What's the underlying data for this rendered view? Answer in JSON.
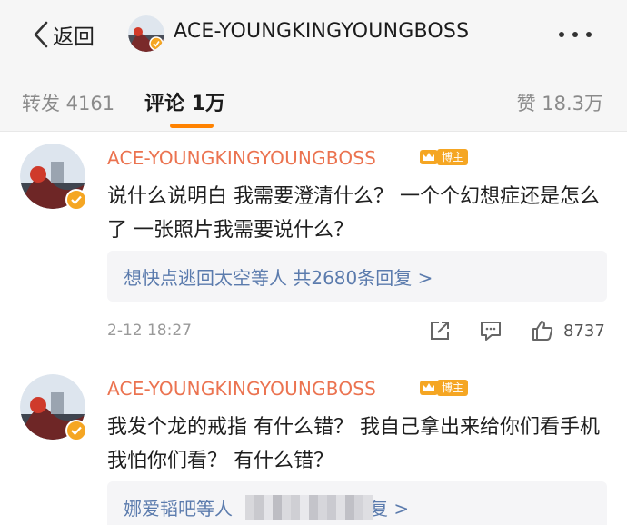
{
  "header": {
    "back_label": "返回",
    "title": "ACE-YOUNGKINGYOUNGBOSS"
  },
  "tabs": {
    "repost": "转发 4161",
    "comment": "评论 1万",
    "like": "赞 18.3万"
  },
  "colors": {
    "accent": "#ff8200",
    "username": "#eb7350",
    "link": "#5b7bad",
    "badge": "#f5a623"
  },
  "comments": [
    {
      "username": "ACE-YOUNGKINGYOUNGBOSS",
      "badge": "博主",
      "text": "说什么说明白 我需要澄清什么？ 一个个幻想症还是怎么了 一张照片我需要说什么？",
      "reply_summary": "想快点逃回太空等人 共2680条回复 >",
      "time": "2-12 18:27",
      "likes": "8737"
    },
    {
      "username": "ACE-YOUNGKINGYOUNGBOSS",
      "badge": "博主",
      "text": "我发个龙的戒指 有什么错？ 我自己拿出来给你们看手机我怕你们看？ 有什么错？",
      "reply_prefix": "娜爱韬吧等人",
      "reply_suffix": "复 >"
    }
  ],
  "icons": [
    "chevron-left-icon",
    "more-icon",
    "verified-icon",
    "crown-icon",
    "share-icon",
    "comment-icon",
    "like-icon"
  ]
}
